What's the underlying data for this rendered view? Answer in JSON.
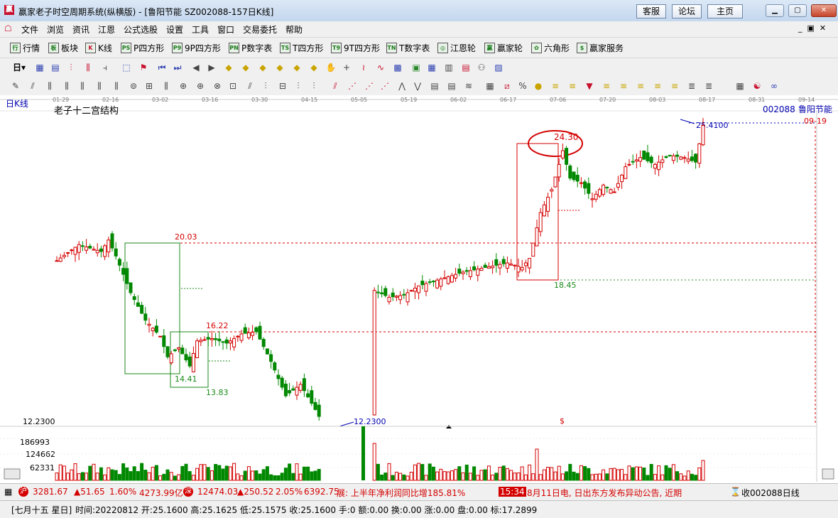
{
  "window": {
    "title": "赢家老子时空周期系统(纵横版) - [鲁阳节能  SZ002088-157日K线]",
    "buttons": [
      "客服",
      "论坛",
      "主页"
    ]
  },
  "menu": [
    "文件",
    "浏览",
    "资讯",
    "江恩",
    "公式选股",
    "设置",
    "工具",
    "窗口",
    "交易委托",
    "帮助"
  ],
  "toolbar1": [
    {
      "icon": "行",
      "label": "行情"
    },
    {
      "icon": "板",
      "label": "板块"
    },
    {
      "icon": "K",
      "label": "K线"
    },
    {
      "icon": "PS",
      "label": "P四方形"
    },
    {
      "icon": "P9",
      "label": "9P四方形"
    },
    {
      "icon": "PN",
      "label": "P数字表"
    },
    {
      "icon": "TS",
      "label": "T四方形"
    },
    {
      "icon": "T9",
      "label": "9T四方形"
    },
    {
      "icon": "TN",
      "label": "T数字表"
    },
    {
      "icon": "◎",
      "label": "江恩轮"
    },
    {
      "icon": "赢",
      "label": "赢家轮"
    },
    {
      "icon": "✿",
      "label": "六角形"
    },
    {
      "icon": "$",
      "label": "赢家服务"
    }
  ],
  "toolbar2_period": "日",
  "chart": {
    "period_label": "日K线",
    "indicator_title": "老子十二宫结构",
    "stock_code": "002088",
    "stock_name": "鲁阳节能",
    "date_ticks": [
      "01-29",
      "02-16",
      "03-02",
      "03-16",
      "03-30",
      "04-15",
      "05-05",
      "05-19",
      "06-02",
      "06-17",
      "07-06",
      "07-20",
      "08-03",
      "08-17",
      "08-31",
      "09-14"
    ],
    "price_levels": {
      "high": "25.4100",
      "high_date": "09-19",
      "low": "12.2300",
      "low_axis": "12.2300",
      "l1": "20.03",
      "l2": "16.22",
      "l3": "14.41",
      "l4": "13.83",
      "l5": "24.30",
      "l6": "18.45"
    },
    "dollar_mark": "$",
    "volume_axis": [
      "186993",
      "124662",
      "62331"
    ],
    "colors": {
      "up": "#d40000",
      "down": "#008800",
      "box": "#1b8a1b"
    }
  },
  "chart_data": {
    "type": "candlestick",
    "title": "老子十二宫结构",
    "series_name": "鲁阳节能 002088",
    "high": 25.41,
    "low": 12.23,
    "levels": [
      20.03,
      16.22,
      14.41,
      13.83,
      24.3,
      18.45
    ],
    "volume_ticks": [
      186993,
      124662,
      62331
    ]
  },
  "status1": {
    "sh_index": "3281.67",
    "sh_change": "▲51.65",
    "sh_pct": "1.60%",
    "sh_amount": "4273.99亿",
    "sz_index": "12474.03",
    "sz_change": "▲250.52",
    "sz_pct": "2.05%",
    "sz_amount": "6392.75",
    "news1": "展: 上半年净利润同比增185.81%",
    "news_time": "15:34",
    "news2": "8月11日电, 日出东方发布异动公告, 近期",
    "ticker": "收002088日线"
  },
  "status2": {
    "lunar": "[七月十五 星日]",
    "info": "时间:20220812 开:25.1600 高:25.1625 低:25.1575 收:25.1600 手:0 额:0.00 换:0.00 涨:0.00 盘:0.00 标:17.2899"
  }
}
